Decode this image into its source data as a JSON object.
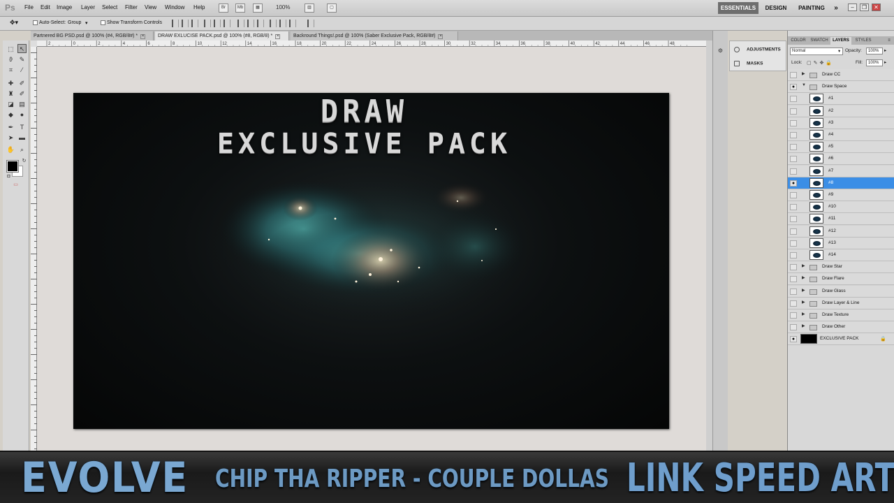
{
  "menubar": {
    "logo": "Ps",
    "items": [
      "File",
      "Edit",
      "Image",
      "Layer",
      "Select",
      "Filter",
      "View",
      "Window",
      "Help"
    ],
    "zoom": "100%",
    "workspaces": [
      "ESSENTIALS",
      "DESIGN",
      "PAINTING",
      "»"
    ]
  },
  "options_bar": {
    "auto_select_label": "Auto-Select:",
    "auto_select_value": "Group",
    "show_transform_label": "Show Transform Controls"
  },
  "tabs": [
    {
      "label": "Partnered BG PSD.psd @ 100% (#4, RGB/8#) *",
      "active": false
    },
    {
      "label": "DRAW EXLUCISE PACK.psd @ 100% (#8, RGB/8) *",
      "active": true
    },
    {
      "label": "Backround Things!.psd @ 100% (Saber Exclusive Pack, RGB/8#)",
      "active": false
    }
  ],
  "ruler_labels": [
    "2",
    "0",
    "2",
    "4",
    "6",
    "8",
    "10",
    "12",
    "14",
    "16",
    "18",
    "20",
    "22",
    "24",
    "26",
    "28",
    "30",
    "32",
    "34",
    "36",
    "38",
    "40",
    "42",
    "44",
    "46",
    "48"
  ],
  "document": {
    "title_line1": "DRAW",
    "title_line2": "EXCLUSIVE PACK"
  },
  "adjustments": {
    "items": [
      "ADJUSTMENTS",
      "MASKS"
    ]
  },
  "layers_panel": {
    "tabs": [
      "COLOR",
      "SWATCH",
      "LAYERS",
      "STYLES"
    ],
    "blend_mode": "Normal",
    "opacity_label": "Opacity:",
    "opacity_value": "100%",
    "lock_label": "Lock:",
    "fill_label": "Fill:",
    "fill_value": "100%",
    "layers": [
      {
        "name": "Draw CC",
        "kind": "group",
        "expanded": false,
        "visible": false,
        "selected": false
      },
      {
        "name": "Draw Space",
        "kind": "group",
        "expanded": true,
        "visible": true,
        "selected": false
      },
      {
        "name": "#1",
        "kind": "layer",
        "visible": false,
        "selected": false
      },
      {
        "name": "#2",
        "kind": "layer",
        "visible": false,
        "selected": false
      },
      {
        "name": "#3",
        "kind": "layer",
        "visible": false,
        "selected": false
      },
      {
        "name": "#4",
        "kind": "layer",
        "visible": false,
        "selected": false
      },
      {
        "name": "#5",
        "kind": "layer",
        "visible": false,
        "selected": false
      },
      {
        "name": "#6",
        "kind": "layer",
        "visible": false,
        "selected": false
      },
      {
        "name": "#7",
        "kind": "layer",
        "visible": false,
        "selected": false
      },
      {
        "name": "#8",
        "kind": "layer",
        "visible": true,
        "selected": true
      },
      {
        "name": "#9",
        "kind": "layer",
        "visible": false,
        "selected": false
      },
      {
        "name": "#10",
        "kind": "layer",
        "visible": false,
        "selected": false
      },
      {
        "name": "#11",
        "kind": "layer",
        "visible": false,
        "selected": false
      },
      {
        "name": "#12",
        "kind": "layer",
        "visible": false,
        "selected": false
      },
      {
        "name": "#13",
        "kind": "layer",
        "visible": false,
        "selected": false
      },
      {
        "name": "#14",
        "kind": "layer",
        "visible": false,
        "selected": false
      },
      {
        "name": "Draw Star",
        "kind": "group",
        "expanded": false,
        "visible": false,
        "selected": false
      },
      {
        "name": "Draw Flare",
        "kind": "group",
        "expanded": false,
        "visible": false,
        "selected": false
      },
      {
        "name": "Draw Glass",
        "kind": "group",
        "expanded": false,
        "visible": false,
        "selected": false
      },
      {
        "name": "Draw Layer & Line",
        "kind": "group",
        "expanded": false,
        "visible": false,
        "selected": false
      },
      {
        "name": "Draw Texture",
        "kind": "group",
        "expanded": false,
        "visible": false,
        "selected": false
      },
      {
        "name": "Draw Other",
        "kind": "group",
        "expanded": false,
        "visible": false,
        "selected": false
      },
      {
        "name": "EXCLUSIVE PACK",
        "kind": "background",
        "visible": true,
        "selected": false,
        "locked": true
      }
    ]
  },
  "banner": {
    "left": "EVOLVE",
    "middle": "CHIP THA RIPPER - COUPLE DOLLAS",
    "right": "LINK SPEED ART"
  },
  "colors": {
    "selection": "#3b8ee6",
    "banner_text": "#6fa0cc",
    "workspace_active": "#6e6e6e"
  }
}
